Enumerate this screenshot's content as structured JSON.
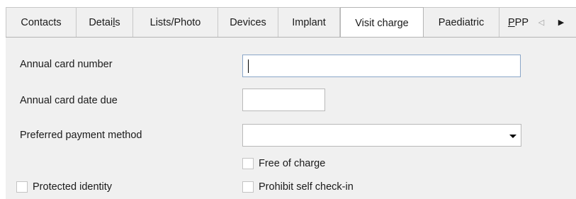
{
  "tabs": [
    {
      "label": "Contacts"
    },
    {
      "label_pre": "Detai",
      "label_u": "l",
      "label_post": "s"
    },
    {
      "label": "Lists/Photo"
    },
    {
      "label": "Devices"
    },
    {
      "label": "Implant"
    },
    {
      "label": "Visit charge",
      "active": true
    },
    {
      "label": "Paediatric"
    },
    {
      "label_u": "P",
      "label_post": "PP"
    }
  ],
  "tab_scroll": {
    "left_icon": "triangle-left-outline",
    "right_icon": "triangle-right"
  },
  "form": {
    "annual_card_number": {
      "label": "Annual card number",
      "value": ""
    },
    "annual_card_date_due": {
      "label": "Annual card date due",
      "value": ""
    },
    "preferred_payment_method": {
      "label": "Preferred payment method",
      "value": ""
    },
    "free_of_charge": {
      "label": "Free of charge",
      "checked": false
    },
    "protected_identity": {
      "label": "Protected identity",
      "checked": false
    },
    "prohibit_self_checkin": {
      "label": "Prohibit self check-in",
      "checked": false
    }
  }
}
